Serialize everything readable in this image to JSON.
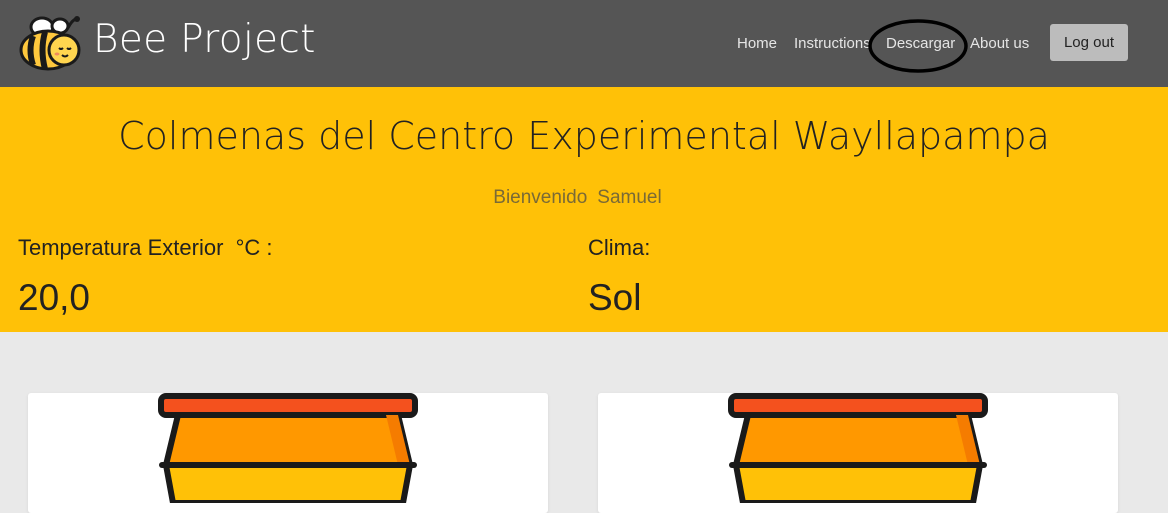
{
  "navbar": {
    "brand": "Bee Project",
    "links": [
      "Home",
      "Instructions",
      "Descargar",
      "About us"
    ],
    "logout_label": "Log out",
    "background": "#555555"
  },
  "hero": {
    "title": "Colmenas del Centro Experimental Wayllapampa",
    "welcome_word": "Bienvenido",
    "user_name": "Samuel",
    "temperature_label": "Temperatura Exterior  °C :",
    "temperature_value": "20,0",
    "weather_label": "Clima:",
    "weather_value": "Sol",
    "background": "#ffc107"
  },
  "cards": [
    {
      "icon": "beehive-icon"
    },
    {
      "icon": "beehive-icon"
    }
  ]
}
